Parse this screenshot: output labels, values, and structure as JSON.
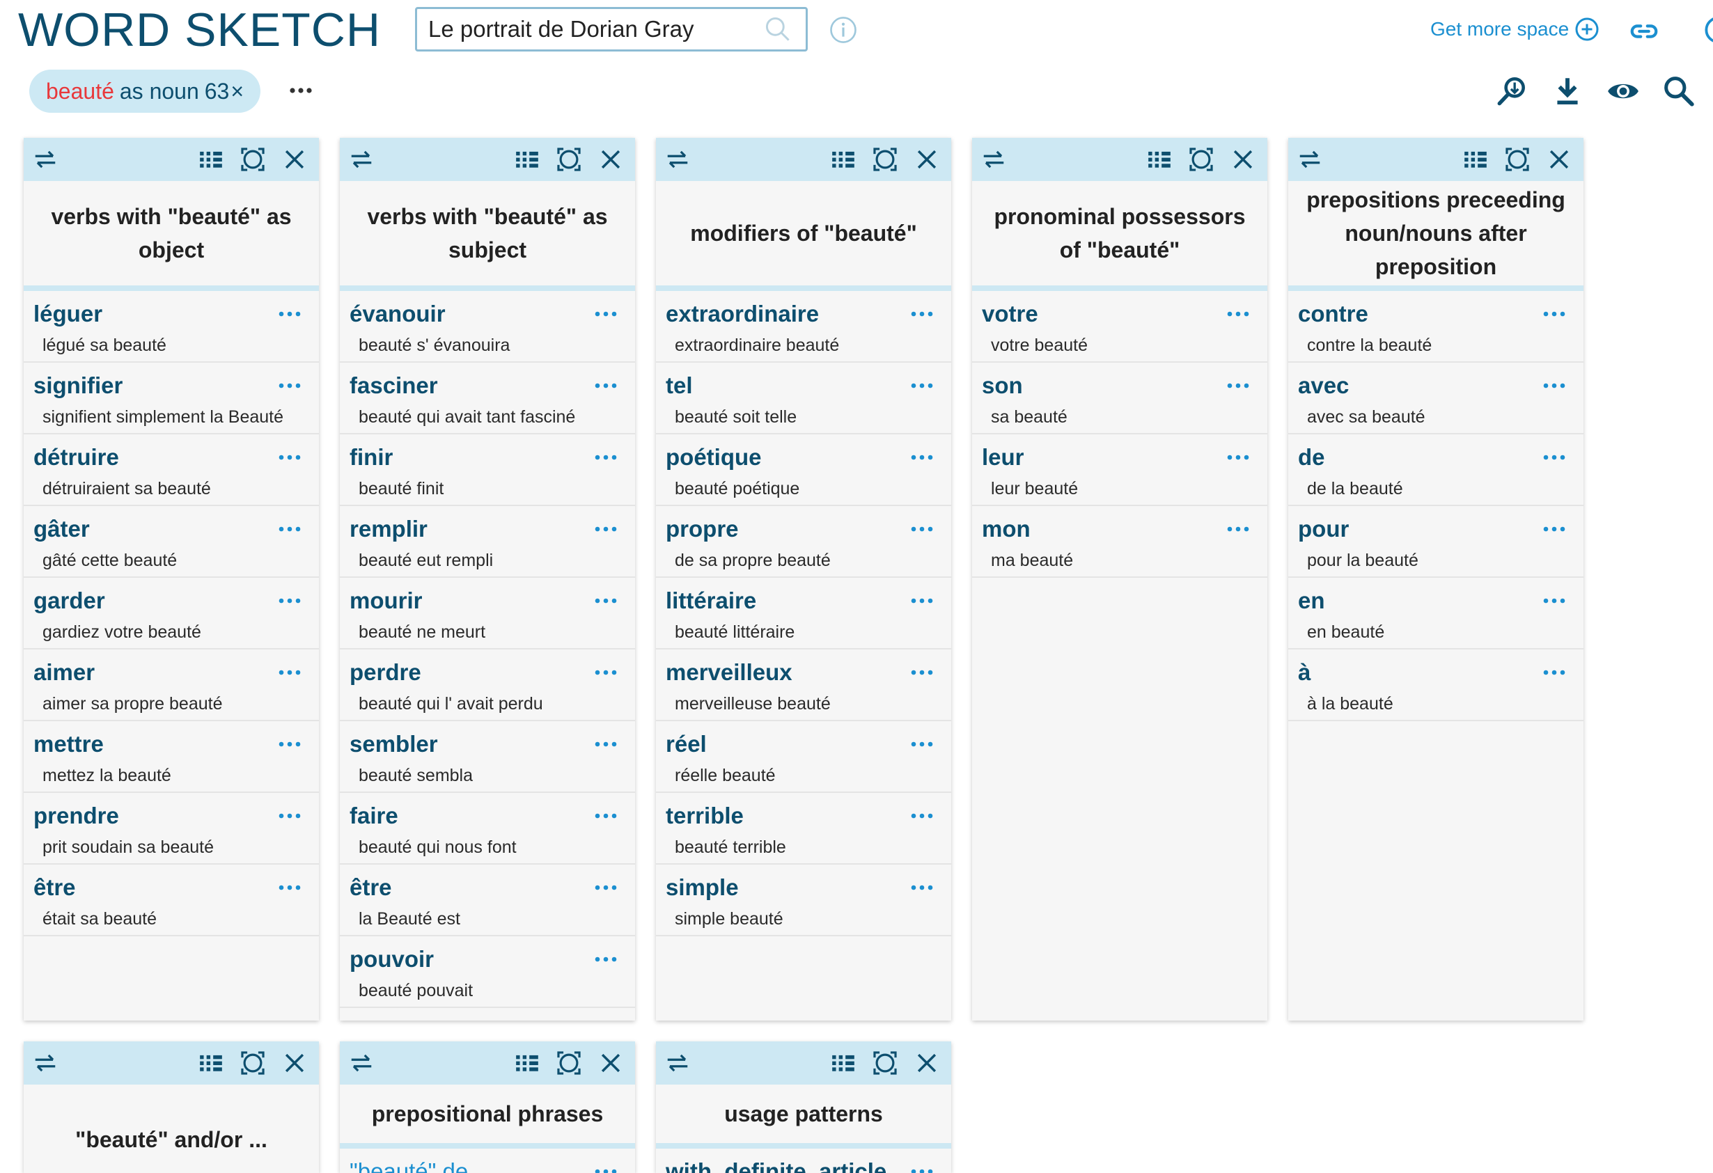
{
  "header": {
    "app_title": "WORD SKETCH",
    "search_value": "Le portrait de Dorian Gray",
    "get_more_space": "Get more space"
  },
  "query": {
    "lemma": "beauté",
    "pos_text": "as noun",
    "count": "63",
    "close": "×"
  },
  "icons": {
    "search": "search-icon",
    "info": "info-icon",
    "add": "plus-circle-icon",
    "link": "link-icon",
    "more": "more-horizontal-icon",
    "zoom": "zoom-icon",
    "download": "download-icon",
    "view": "eye-icon",
    "find": "search-icon",
    "swap": "swap-icon",
    "layout": "layout-icon",
    "fullscreen": "fullscreen-icon",
    "close": "close-icon"
  },
  "colors": {
    "title": "#0d4e6e",
    "accent": "#1b8fd0",
    "lemma": "#e8383b",
    "panel_header": "#cde8f3",
    "panel_bg": "#f6f6f6"
  },
  "panels": [
    {
      "title": "verbs with \"beauté\" as object",
      "rows": [
        {
          "word": "léguer",
          "example": "légué sa beauté"
        },
        {
          "word": "signifier",
          "example": "signifient simplement la Beauté"
        },
        {
          "word": "détruire",
          "example": "détruiraient sa beauté"
        },
        {
          "word": "gâter",
          "example": "gâté cette beauté"
        },
        {
          "word": "garder",
          "example": "gardiez votre beauté"
        },
        {
          "word": "aimer",
          "example": "aimer sa propre beauté"
        },
        {
          "word": "mettre",
          "example": "mettez la beauté"
        },
        {
          "word": "prendre",
          "example": "prit soudain sa beauté"
        },
        {
          "word": "être",
          "example": "était sa beauté"
        }
      ]
    },
    {
      "title": "verbs with \"beauté\" as subject",
      "rows": [
        {
          "word": "évanouir",
          "example": "beauté s' évanouira"
        },
        {
          "word": "fasciner",
          "example": "beauté qui avait tant fasciné"
        },
        {
          "word": "finir",
          "example": "beauté finit"
        },
        {
          "word": "remplir",
          "example": "beauté eut rempli"
        },
        {
          "word": "mourir",
          "example": "beauté ne meurt"
        },
        {
          "word": "perdre",
          "example": "beauté qui l' avait perdu"
        },
        {
          "word": "sembler",
          "example": "beauté sembla"
        },
        {
          "word": "faire",
          "example": "beauté qui nous font"
        },
        {
          "word": "être",
          "example": "la Beauté est"
        },
        {
          "word": "pouvoir",
          "example": "beauté pouvait"
        }
      ]
    },
    {
      "title": "modifiers of \"beauté\"",
      "rows": [
        {
          "word": "extraordinaire",
          "example": "extraordinaire beauté"
        },
        {
          "word": "tel",
          "example": "beauté soit telle"
        },
        {
          "word": "poétique",
          "example": "beauté poétique"
        },
        {
          "word": "propre",
          "example": "de sa propre beauté"
        },
        {
          "word": "littéraire",
          "example": "beauté littéraire"
        },
        {
          "word": "merveilleux",
          "example": "merveilleuse beauté"
        },
        {
          "word": "réel",
          "example": "réelle beauté"
        },
        {
          "word": "terrible",
          "example": "beauté terrible"
        },
        {
          "word": "simple",
          "example": "simple beauté"
        }
      ]
    },
    {
      "title": "pronominal possessors of \"beauté\"",
      "rows": [
        {
          "word": "votre",
          "example": "votre beauté"
        },
        {
          "word": "son",
          "example": "sa beauté"
        },
        {
          "word": "leur",
          "example": "leur beauté"
        },
        {
          "word": "mon",
          "example": "ma beauté"
        }
      ]
    },
    {
      "title": "prepositions preceeding noun/nouns after preposition",
      "rows": [
        {
          "word": "contre",
          "example": "contre la beauté"
        },
        {
          "word": "avec",
          "example": "avec sa beauté"
        },
        {
          "word": "de",
          "example": "de la beauté"
        },
        {
          "word": "pour",
          "example": "pour la beauté"
        },
        {
          "word": "en",
          "example": "en beauté"
        },
        {
          "word": "à",
          "example": "à la beauté"
        }
      ]
    }
  ],
  "lower_panels": [
    {
      "title": "\"beauté\" and/or ...",
      "first_row": ""
    },
    {
      "title": "prepositional phrases",
      "first_row": "\"beauté\" de"
    },
    {
      "title": "usage patterns",
      "first_row": "with_definite_article"
    }
  ]
}
